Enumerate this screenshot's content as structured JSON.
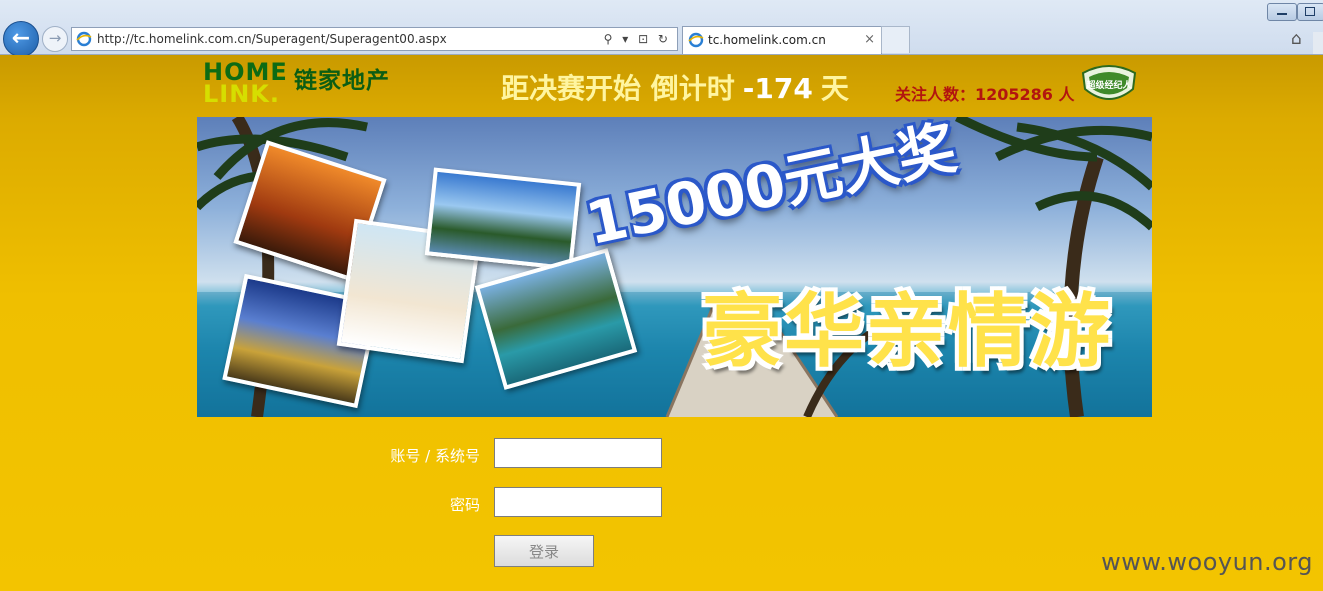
{
  "browser": {
    "back_glyph": "←",
    "forward_glyph": "→",
    "address_url": "http://tc.homelink.com.cn/Superagent/Superagent00.aspx",
    "address_tools": "⚲ ▾ ⊡ ↻",
    "tab_title": "tc.homelink.com.cn",
    "tab_close": "×",
    "home_glyph": "⌂",
    "accent": "#1d5ea8"
  },
  "header": {
    "logo_line1": "HOME",
    "logo_line2": "LINK.",
    "logo_cn": "链家地产",
    "countdown_prefix": "距决赛开始 倒计时",
    "countdown_days": "-174",
    "countdown_unit": "天",
    "followers_text": "关注人数：1205286 人",
    "badge_text": "超级经纪人"
  },
  "banner": {
    "prize_line1": "15000元大奖",
    "prize_line2": "豪华亲情游"
  },
  "login": {
    "account_label": "账号 / 系统号",
    "password_label": "密码",
    "account_value": "",
    "password_value": "",
    "submit_label": "登录"
  },
  "watermark": "www.wooyun.org",
  "colors": {
    "page_bg": "#f1c200",
    "logo_green": "#0d6b14",
    "logo_yellow": "#d6de00",
    "followers_red": "#b2150f"
  }
}
